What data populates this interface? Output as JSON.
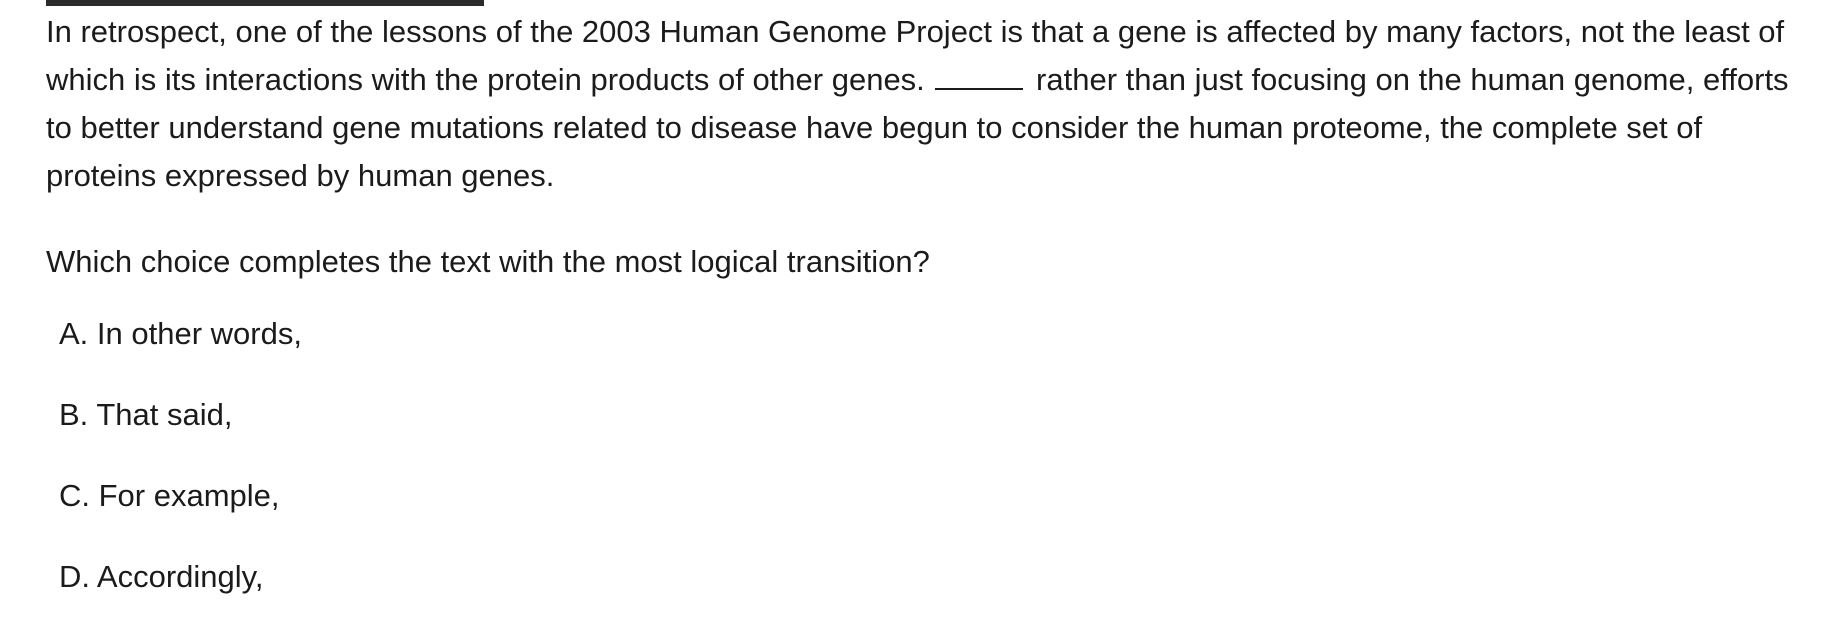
{
  "passage": {
    "before_blank": "In retrospect, one of the lessons of the 2003 Human Genome Project is that a gene is affected by many factors, not the least of which is its interactions with the protein products of other genes.",
    "after_blank": "rather than just focusing on the human genome, efforts to better understand gene mutations related to disease have begun to consider the human proteome, the complete set of proteins expressed by human genes."
  },
  "question": "Which choice completes the text with the most logical transition?",
  "choices": [
    {
      "letter": "A.",
      "text": "In other words,"
    },
    {
      "letter": "B.",
      "text": "That said,"
    },
    {
      "letter": "C.",
      "text": "For example,"
    },
    {
      "letter": "D.",
      "text": "Accordingly,"
    }
  ]
}
